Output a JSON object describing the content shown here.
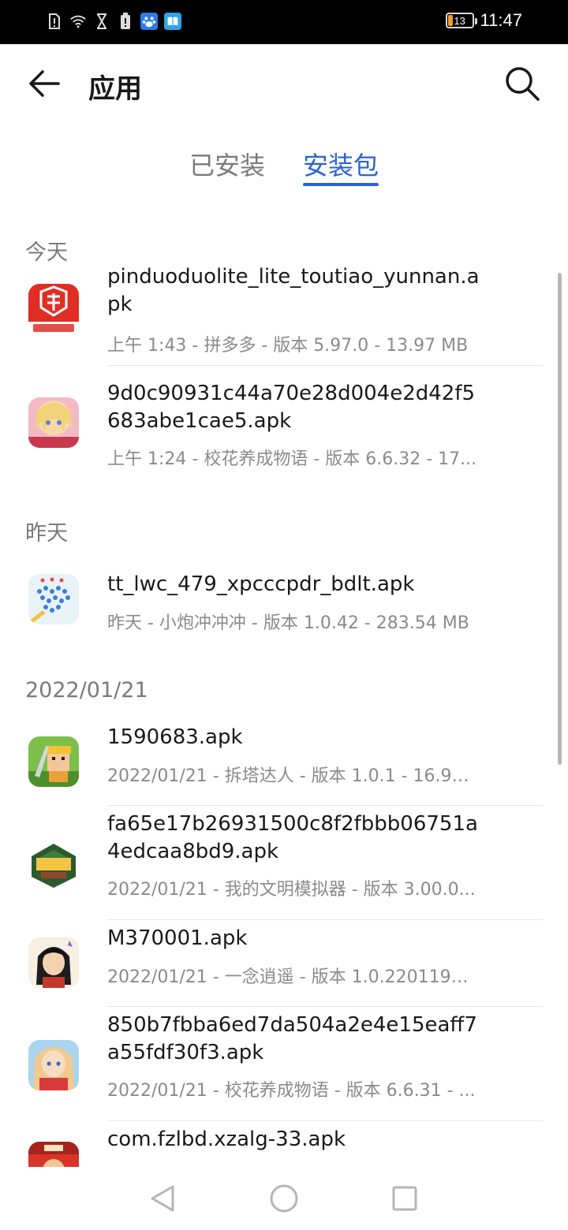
{
  "status_bar": {
    "time": "11:47",
    "battery_level": "13",
    "battery_color": "#f29a38",
    "left_icons": [
      "sim-alert-icon",
      "wifi-icon",
      "hourglass-icon",
      "phone-alert-icon",
      "baidu-paw-icon",
      "reader-book-icon"
    ]
  },
  "header": {
    "title": "应用",
    "back_icon": "arrow-left-icon",
    "search_icon": "search-icon"
  },
  "tabs": [
    {
      "label": "已安装",
      "active": false
    },
    {
      "label": "安装包",
      "active": true
    }
  ],
  "accent_color": "#2a62d4",
  "sections": [
    {
      "title": "今天",
      "items": [
        {
          "file": "pinduoduolite_lite_toutiao_yunnan.apk",
          "meta": "上午 1:43  - 拼多多 - 版本 5.97.0 - 13.97 MB",
          "icon": "pinduoduo-app-icon"
        },
        {
          "file": "9d0c90931c44a70e28d004e2d42f5683abe1cae5.apk",
          "meta": "上午 1:24  - 校花养成物语 - 版本 6.6.32 - 17...",
          "icon": "anime-girl-app-icon"
        }
      ]
    },
    {
      "title": "昨天",
      "items": [
        {
          "file": "tt_lwc_479_xpcccpdr_bdlt.apk",
          "meta": "昨天 - 小炮冲冲冲 - 版本 1.0.42 - 283.54 MB",
          "icon": "crowd-game-app-icon"
        }
      ]
    },
    {
      "title": "2022/01/21",
      "items": [
        {
          "file": "1590683.apk",
          "meta": "2022/01/21 - 拆塔达人 - 版本 1.0.1 - 16.92 ...",
          "icon": "blocky-warrior-app-icon"
        },
        {
          "file": "fa65e17b26931500c8f2fbbb06751a4edcaa8bd9.apk",
          "meta": "2022/01/21 - 我的文明模拟器 - 版本 3.00.0...",
          "icon": "civilization-app-icon"
        },
        {
          "file": "M370001.apk",
          "meta": "2022/01/21 - 一念逍遥 - 版本 1.0.2201190...",
          "icon": "cultivation-app-icon"
        },
        {
          "file": "850b7fbba6ed7da504a2e4e15eaff7a55fdf30f3.apk",
          "meta": "2022/01/21 - 校花养成物语 - 版本 6.6.31 - ...",
          "icon": "anime-girl-app-icon"
        },
        {
          "file": "com.fzlbd.xzalg-33.apk",
          "meta": "",
          "icon": "red-game-app-icon"
        }
      ]
    }
  ],
  "nav": [
    "back-triangle-icon",
    "home-circle-icon",
    "recents-square-icon"
  ]
}
